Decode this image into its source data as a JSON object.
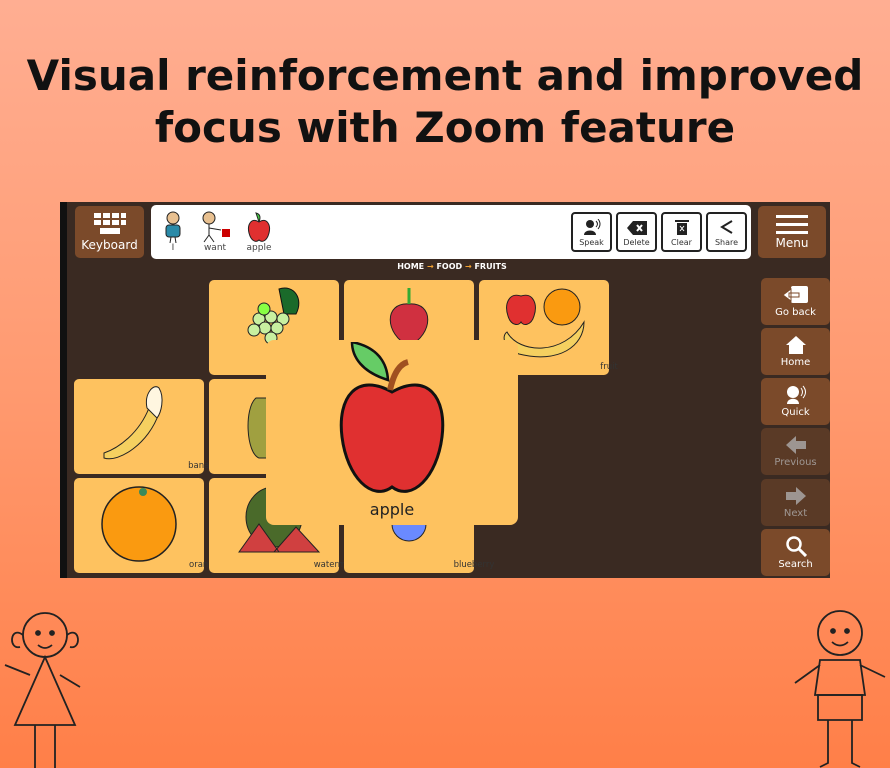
{
  "headline": {
    "line1": "Visual reinforcement and improved",
    "line2": "focus with Zoom feature"
  },
  "toolbar": {
    "keyboard": "Keyboard",
    "menu": "Menu",
    "sentence": [
      {
        "label": "I",
        "icon": "person-icon"
      },
      {
        "label": "want",
        "icon": "want-icon"
      },
      {
        "label": "apple",
        "icon": "apple-icon"
      }
    ],
    "actions": [
      {
        "label": "Speak",
        "icon": "speak-icon"
      },
      {
        "label": "Delete",
        "icon": "backspace-icon"
      },
      {
        "label": "Clear",
        "icon": "trash-icon"
      },
      {
        "label": "Share",
        "icon": "share-icon"
      }
    ]
  },
  "breadcrumb": [
    "HOME",
    "FOOD",
    "FRUITS"
  ],
  "tiles": [
    {
      "label": "",
      "icon": "grapes-icon"
    },
    {
      "label": "",
      "icon": "strawberry-icon"
    },
    {
      "label": "fruit",
      "icon": "fruit-icon"
    },
    {
      "label": "banana",
      "icon": "banana-icon"
    },
    {
      "label": "",
      "icon": "pear-icon"
    },
    {
      "label": "orange",
      "icon": "orange-icon"
    },
    {
      "label": "watermelon",
      "icon": "watermelon-icon"
    },
    {
      "label": "blueberry",
      "icon": "blueberry-icon"
    }
  ],
  "zoomed": {
    "label": "apple",
    "icon": "apple-icon"
  },
  "side_nav": [
    {
      "label": "Go back",
      "icon": "go-back-icon",
      "enabled": true
    },
    {
      "label": "Home",
      "icon": "home-icon",
      "enabled": true
    },
    {
      "label": "Quick",
      "icon": "quick-icon",
      "enabled": true
    },
    {
      "label": "Previous",
      "icon": "arrow-left-icon",
      "enabled": false
    },
    {
      "label": "Next",
      "icon": "arrow-right-icon",
      "enabled": false
    },
    {
      "label": "Search",
      "icon": "search-icon",
      "enabled": true
    }
  ],
  "colors": {
    "panel": "#3a2a22",
    "button": "#7b4a2a",
    "tile": "#fec25f"
  }
}
